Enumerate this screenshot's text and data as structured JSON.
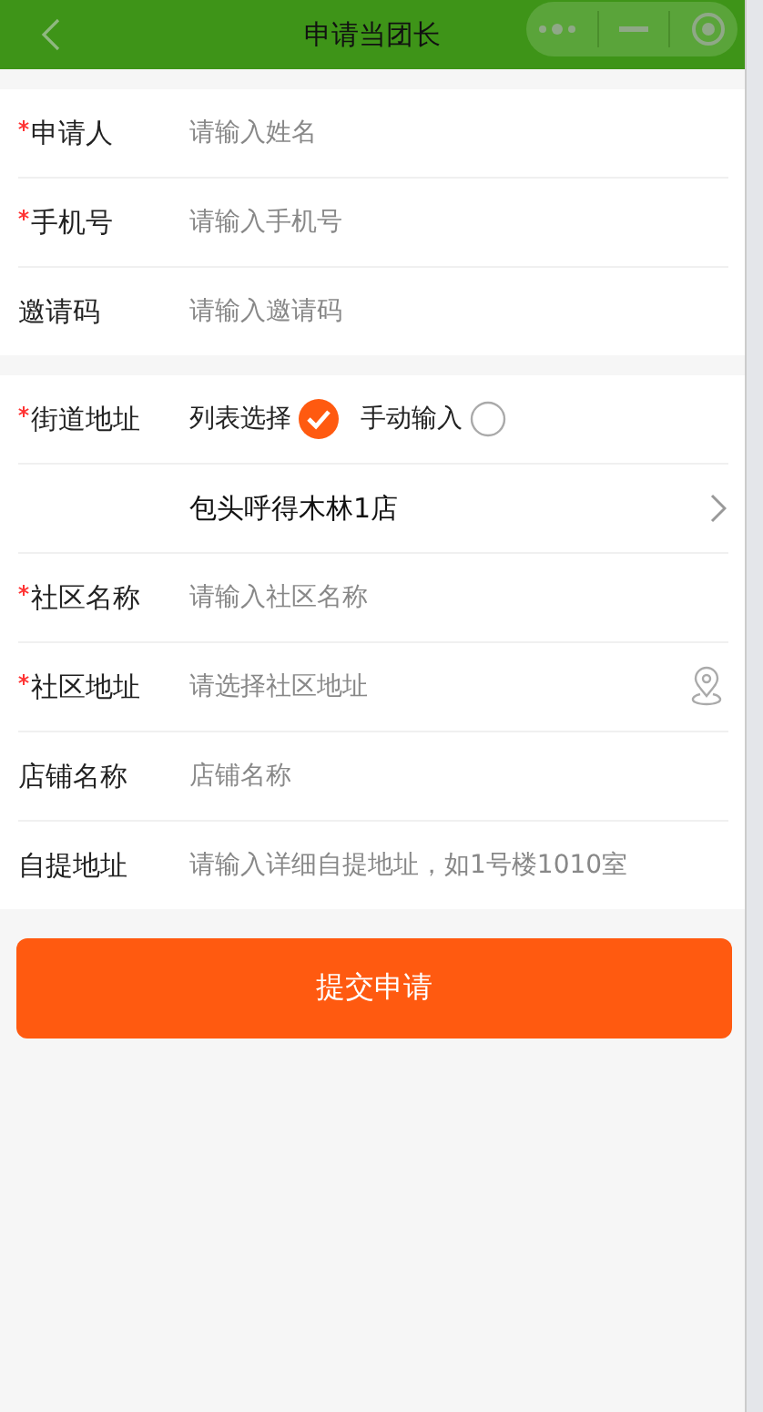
{
  "header": {
    "title": "申请当团长"
  },
  "groups": [
    {
      "rows": [
        {
          "kind": "input",
          "label": "申请人",
          "required": true,
          "placeholder": "请输入姓名"
        },
        {
          "kind": "input",
          "label": "手机号",
          "required": true,
          "placeholder": "请输入手机号"
        },
        {
          "kind": "input",
          "label": "邀请码",
          "required": false,
          "placeholder": "请输入邀请码"
        }
      ]
    },
    {
      "rows": [
        {
          "kind": "radio",
          "label": "街道地址",
          "required": true,
          "options": [
            {
              "label": "列表选择",
              "selected": true
            },
            {
              "label": "手动输入",
              "selected": false
            }
          ]
        },
        {
          "kind": "select",
          "value": "包头呼得木林1店"
        },
        {
          "kind": "input",
          "label": "社区名称",
          "required": true,
          "placeholder": "请输入社区名称"
        },
        {
          "kind": "location",
          "label": "社区地址",
          "required": true,
          "placeholder": "请选择社区地址"
        },
        {
          "kind": "input",
          "label": "店铺名称",
          "required": false,
          "placeholder": "店铺名称"
        },
        {
          "kind": "input",
          "label": "自提地址",
          "required": false,
          "placeholder": "请输入详细自提地址，如1号楼1010室"
        }
      ]
    }
  ],
  "submit": "提交申请"
}
